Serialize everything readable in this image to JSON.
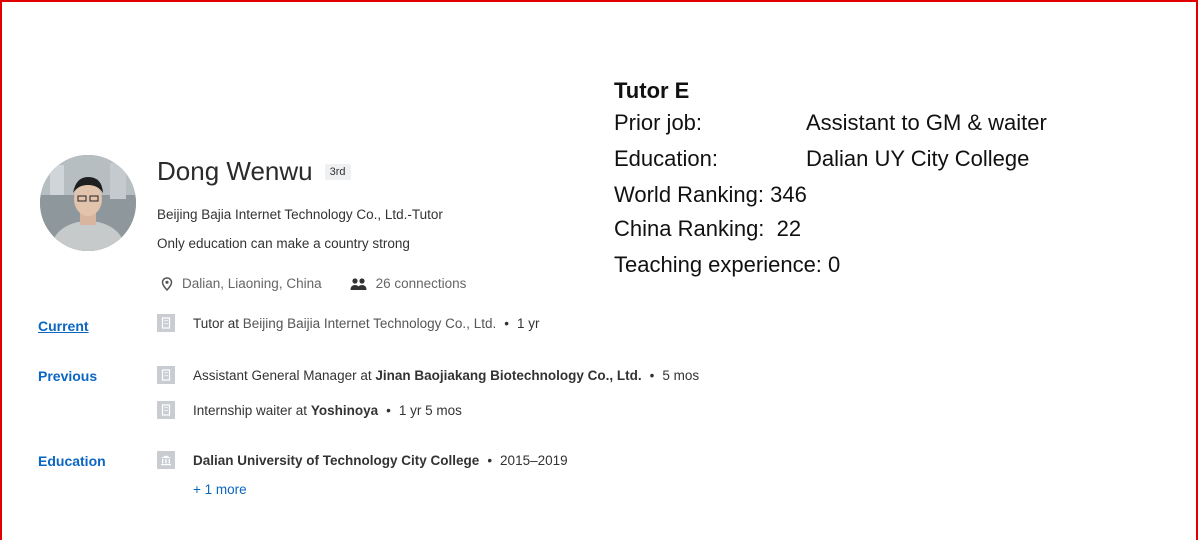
{
  "profile": {
    "name": "Dong Wenwu",
    "degree": "3rd",
    "headline": "Beijing Bajia Internet Technology Co., Ltd.-Tutor",
    "tagline": "Only education can make a country strong",
    "location": "Dalian, Liaoning, China",
    "connections": "26 connections"
  },
  "overlay": {
    "title": "Tutor E",
    "rows": [
      {
        "label": "Prior job:",
        "value": "Assistant to GM & waiter"
      },
      {
        "label": "Education:",
        "value": "Dalian UY City College"
      },
      {
        "label": "World Ranking: 346",
        "value": ""
      },
      {
        "label": "China Ranking:  22",
        "value": ""
      },
      {
        "label": "Teaching experience: 0",
        "value": ""
      }
    ]
  },
  "sections": {
    "current": {
      "label": "Current",
      "items": [
        {
          "role": "Tutor at",
          "org": "Beijing Baijia Internet Technology Co., Ltd.",
          "duration": "1 yr"
        }
      ]
    },
    "previous": {
      "label": "Previous",
      "items": [
        {
          "role": "Assistant General Manager at",
          "org": "Jinan Baojiakang Biotechnology Co., Ltd.",
          "duration": "5 mos"
        },
        {
          "role": "Internship waiter at",
          "org": "Yoshinoya",
          "duration": "1 yr 5 mos"
        }
      ]
    },
    "education": {
      "label": "Education",
      "items": [
        {
          "org": "Dalian University of Technology City College",
          "duration": "2015–2019"
        }
      ],
      "more": "+ 1 more"
    }
  },
  "colors": {
    "link": "#0a66c2",
    "frame": "#e00000"
  }
}
